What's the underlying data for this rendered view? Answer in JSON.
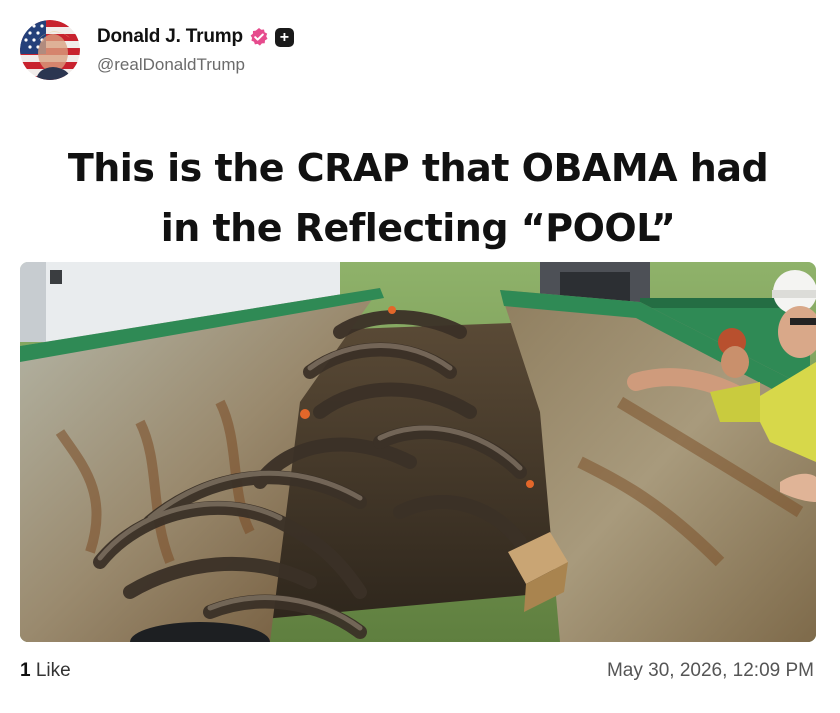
{
  "author": {
    "display_name": "Donald J. Trump",
    "handle": "@realDonaldTrump",
    "verified_icon": "verified-badge-icon",
    "plus_icon": "plus-badge-icon",
    "plus_label": "+"
  },
  "post": {
    "headline_line1": "This is the CRAP that OBAMA had",
    "headline_line2": "in the Reflecting “POOL”",
    "media_kind": "photo"
  },
  "footer": {
    "like_count": "1",
    "like_label": " Like",
    "timestamp": "May 30, 2026, 12:09 PM"
  },
  "colors": {
    "verified_badge": "#e64b8d",
    "dumpster_green": "#2f8a55",
    "rust": "#8a5a30",
    "text_secondary": "#6b6b6b"
  }
}
